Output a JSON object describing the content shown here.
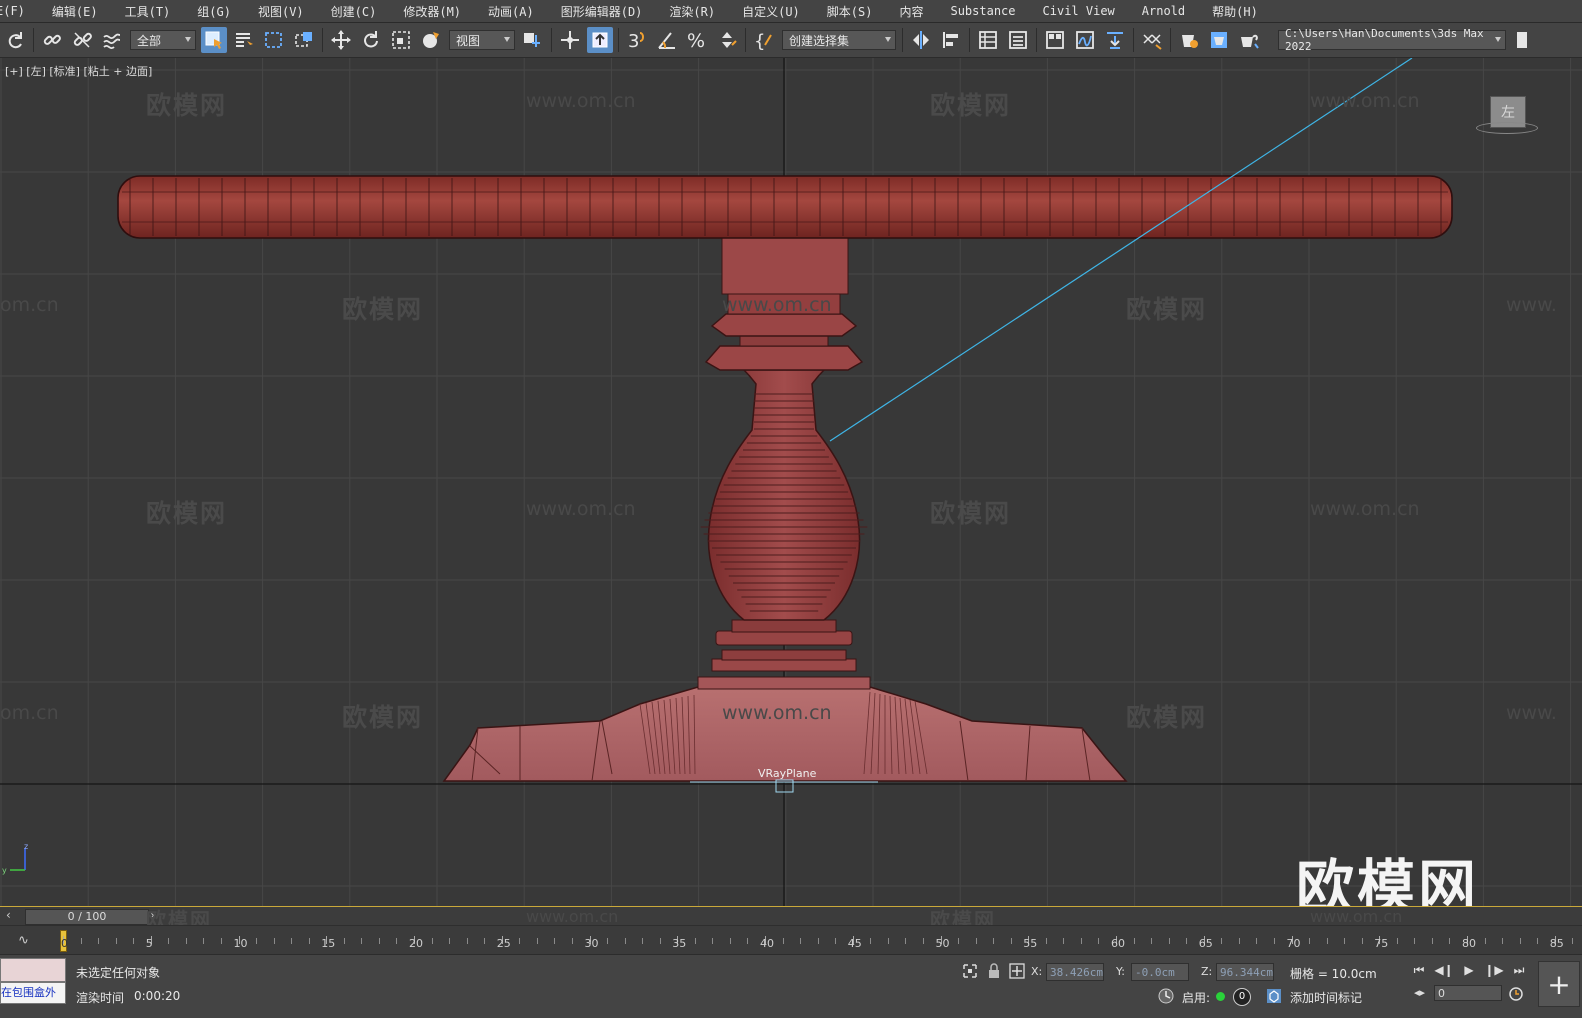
{
  "menu": [
    "E(F)",
    "编辑(E)",
    "工具(T)",
    "组(G)",
    "视图(V)",
    "创建(C)",
    "修改器(M)",
    "动画(A)",
    "图形编辑器(D)",
    "渲染(R)",
    "自定义(U)",
    "脚本(S)",
    "内容",
    "Substance",
    "Civil View",
    "Arnold",
    "帮助(H)"
  ],
  "toolbar": {
    "selection_filter": "全部",
    "ref_coord": "视图",
    "named_selection": "创建选择集",
    "project_path": "C:\\Users\\Han\\Documents\\3ds Max 2022",
    "snap_label": "3"
  },
  "viewport": {
    "label": "[+] [左] [标准] [粘土 + 边面]",
    "viewcube_face": "左",
    "object_label": "VRayPlane",
    "watermark_cn": "欧模网",
    "watermark_url": "www.om.cn",
    "watermark_url_cut": "om.cn",
    "watermark_url_cut2": "www.",
    "big_watermark": "欧模网",
    "colors": {
      "model": "#9a3b3b",
      "grid": "#474747",
      "axis": "#141414",
      "camera_line": "#3fb5e6"
    }
  },
  "timeline": {
    "frame": "0 / 100",
    "ticks": [
      "0",
      "5",
      "10",
      "15",
      "20",
      "25",
      "30",
      "35",
      "40",
      "45",
      "50",
      "55",
      "60",
      "65",
      "70",
      "75",
      "80",
      "85"
    ]
  },
  "status": {
    "selection": "未选定任何对象",
    "render_time_label": "渲染时间",
    "render_time": "0:00:20",
    "inbox_text": "在包围盒外",
    "x_label": "X:",
    "x": "38.426cm",
    "y_label": "Y:",
    "y": "-0.0cm",
    "z_label": "Z:",
    "z": "96.344cm",
    "grid": "栅格 = 10.0cm",
    "enable": "启用:",
    "counter": "0",
    "add_time_tag": "添加时间标记",
    "current_frame": "0"
  }
}
